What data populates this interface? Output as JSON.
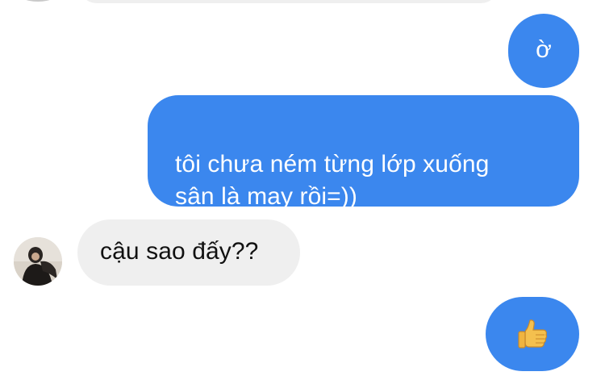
{
  "messages": [
    {
      "direction": "outgoing",
      "text": "ờ"
    },
    {
      "direction": "outgoing",
      "text": "tôi chưa ném từng lớp xuống\nsân là may rồi=))"
    },
    {
      "direction": "incoming",
      "text": "cậu sao đấy??"
    },
    {
      "direction": "outgoing",
      "icon": "thumbs-up-icon"
    }
  ],
  "colors": {
    "outgoing_bubble": "#3b87ee",
    "incoming_bubble": "#efefef"
  }
}
